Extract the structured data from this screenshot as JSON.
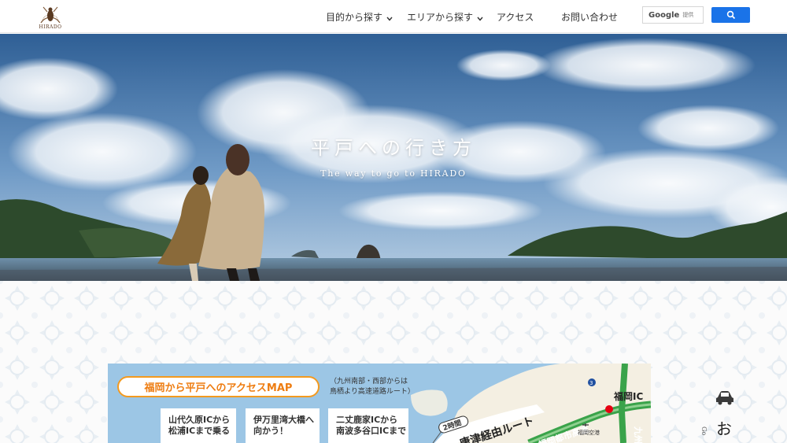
{
  "header": {
    "logo": {
      "emblem_text": "HIRADO",
      "icon": "hirado-emblem-icon"
    },
    "nav": [
      {
        "label": "目的から探す",
        "has_dropdown": true
      },
      {
        "label": "エリアから探す",
        "has_dropdown": true
      },
      {
        "label": "アクセス",
        "has_dropdown": false
      },
      {
        "label": "お問い合わせ",
        "has_dropdown": false
      }
    ],
    "search": {
      "brand": "Google",
      "brand_sub": "提供",
      "button_icon": "search-icon",
      "button_color": "#1a73e8"
    }
  },
  "hero": {
    "title": "平戸への行き方",
    "subtitle": "The way to go to HIRADO"
  },
  "map_card": {
    "title": "福岡から平戸へのアクセスMAP",
    "note_line1": "（九州南部・西部からは",
    "note_line2": "鳥栖より高速道路ルート）",
    "routes": [
      {
        "line1": "山代久原ICから",
        "line2": "松浦ICまで乗る"
      },
      {
        "line1": "伊万里湾大橋へ",
        "line2": "向かう！"
      },
      {
        "line1": "二丈鹿家ICから",
        "line2": "南波多谷口ICまで"
      }
    ],
    "road_label_1": "2時間",
    "road_label_2": "唐津経由ルート",
    "road_label_3": "福岡都市高速",
    "ic_label": "福岡IC",
    "airport_label": "福岡空港",
    "route_number": "3",
    "kyushu_label": "九州",
    "accent_color": "#ee7d12"
  },
  "side_widget": {
    "icon": "car-icon",
    "label": "お",
    "go_label": "Go"
  }
}
